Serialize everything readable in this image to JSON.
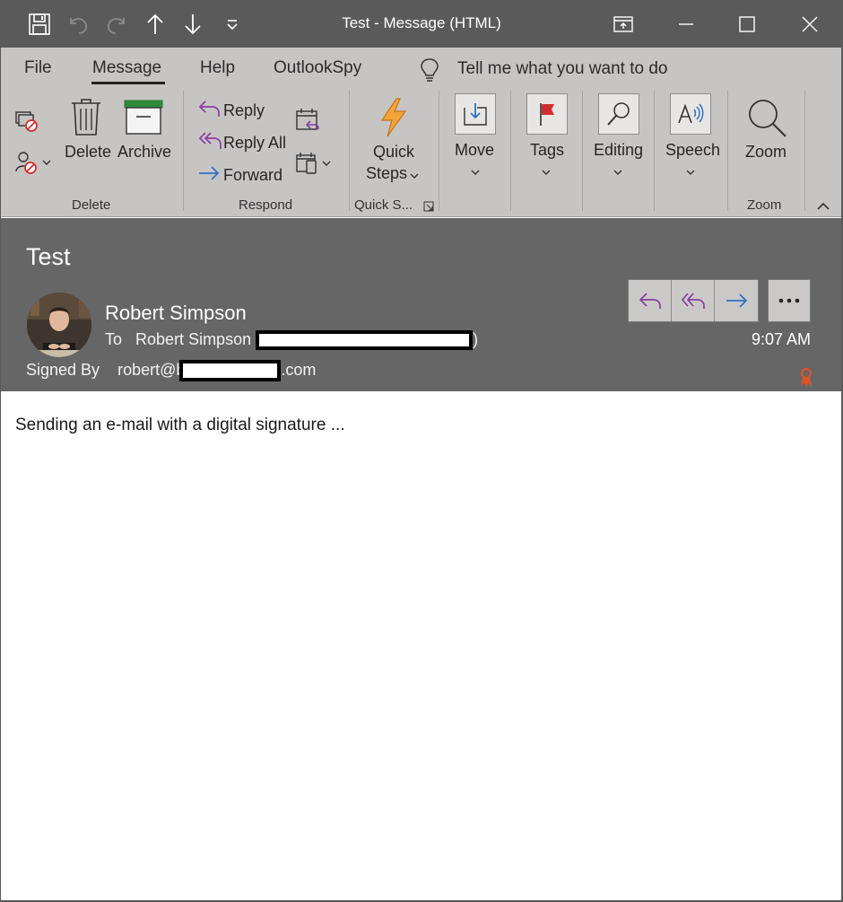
{
  "window": {
    "title": "Test  -  Message (HTML)"
  },
  "quick_access": {
    "icons": [
      "save-icon",
      "undo-icon",
      "redo-icon",
      "previous-item-icon",
      "next-item-icon",
      "customize-toolbar-icon"
    ]
  },
  "window_controls": [
    "ribbon-display-options-icon",
    "minimize-icon",
    "maximize-icon",
    "close-icon"
  ],
  "ribbon": {
    "tabs": [
      {
        "label": "File"
      },
      {
        "label": "Message"
      },
      {
        "label": "Help"
      },
      {
        "label": "OutlookSpy"
      }
    ],
    "active_tab": "Message",
    "tell_me": "Tell me what you want to do",
    "groups": {
      "delete": {
        "label": "Delete",
        "delete_label": "Delete",
        "archive_label": "Archive"
      },
      "respond": {
        "label": "Respond",
        "reply_label": "Reply",
        "reply_all_label": "Reply All",
        "forward_label": "Forward"
      },
      "quick_steps": {
        "label": "Quick S...",
        "button_line1": "Quick",
        "button_line2": "Steps"
      },
      "move": {
        "label": "Move"
      },
      "tags": {
        "label": "Tags"
      },
      "editing": {
        "label": "Editing"
      },
      "speech": {
        "label": "Speech"
      },
      "zoom": {
        "label": "Zoom",
        "button_label": "Zoom"
      }
    }
  },
  "message": {
    "subject": "Test",
    "sender": "Robert Simpson",
    "to_prefix": "To",
    "to_name": "Robert Simpson (",
    "to_suffix": ")",
    "signed_by_label": "Signed By",
    "signed_by_prefix": "robert@b",
    "signed_by_suffix": ".com",
    "time": "9:07 AM",
    "body": "Sending an e-mail with a digital signature ..."
  },
  "colors": {
    "titlebar": "#5a5a5a",
    "ribbon": "#c7c5c4",
    "header": "#666666",
    "reply_purple": "#8a3fa0",
    "forward_blue": "#2f6fc4",
    "quick_steps_orange": "#e48a1e",
    "cert_badge": "#d9532b"
  }
}
